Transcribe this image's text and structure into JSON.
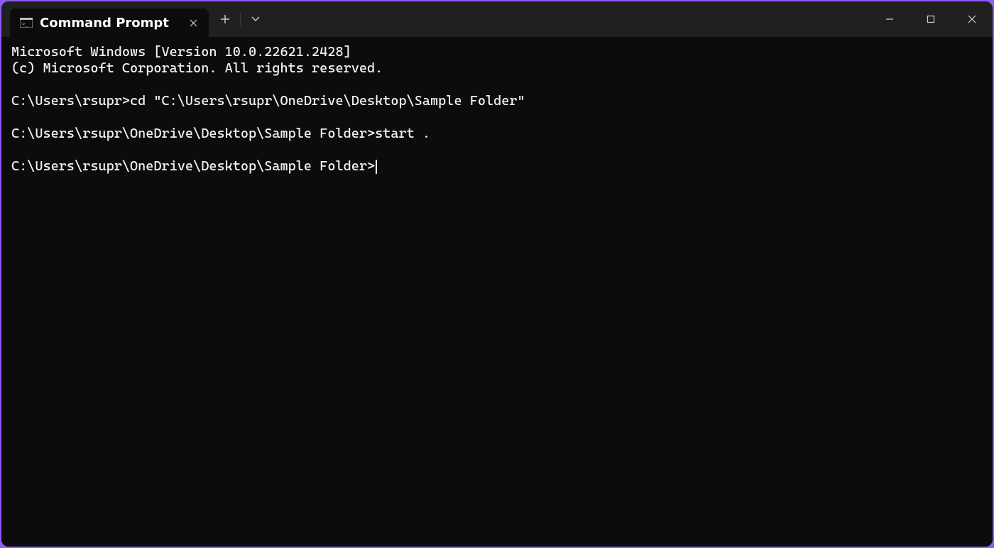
{
  "window": {
    "tab_title": "Command Prompt"
  },
  "terminal": {
    "lines": [
      "Microsoft Windows [Version 10.0.22621.2428]",
      "(c) Microsoft Corporation. All rights reserved.",
      "",
      "C:\\Users\\rsupr>cd \"C:\\Users\\rsupr\\OneDrive\\Desktop\\Sample Folder\"",
      "",
      "C:\\Users\\rsupr\\OneDrive\\Desktop\\Sample Folder>start .",
      "",
      "C:\\Users\\rsupr\\OneDrive\\Desktop\\Sample Folder>"
    ],
    "cursor_on_last_line": true
  }
}
